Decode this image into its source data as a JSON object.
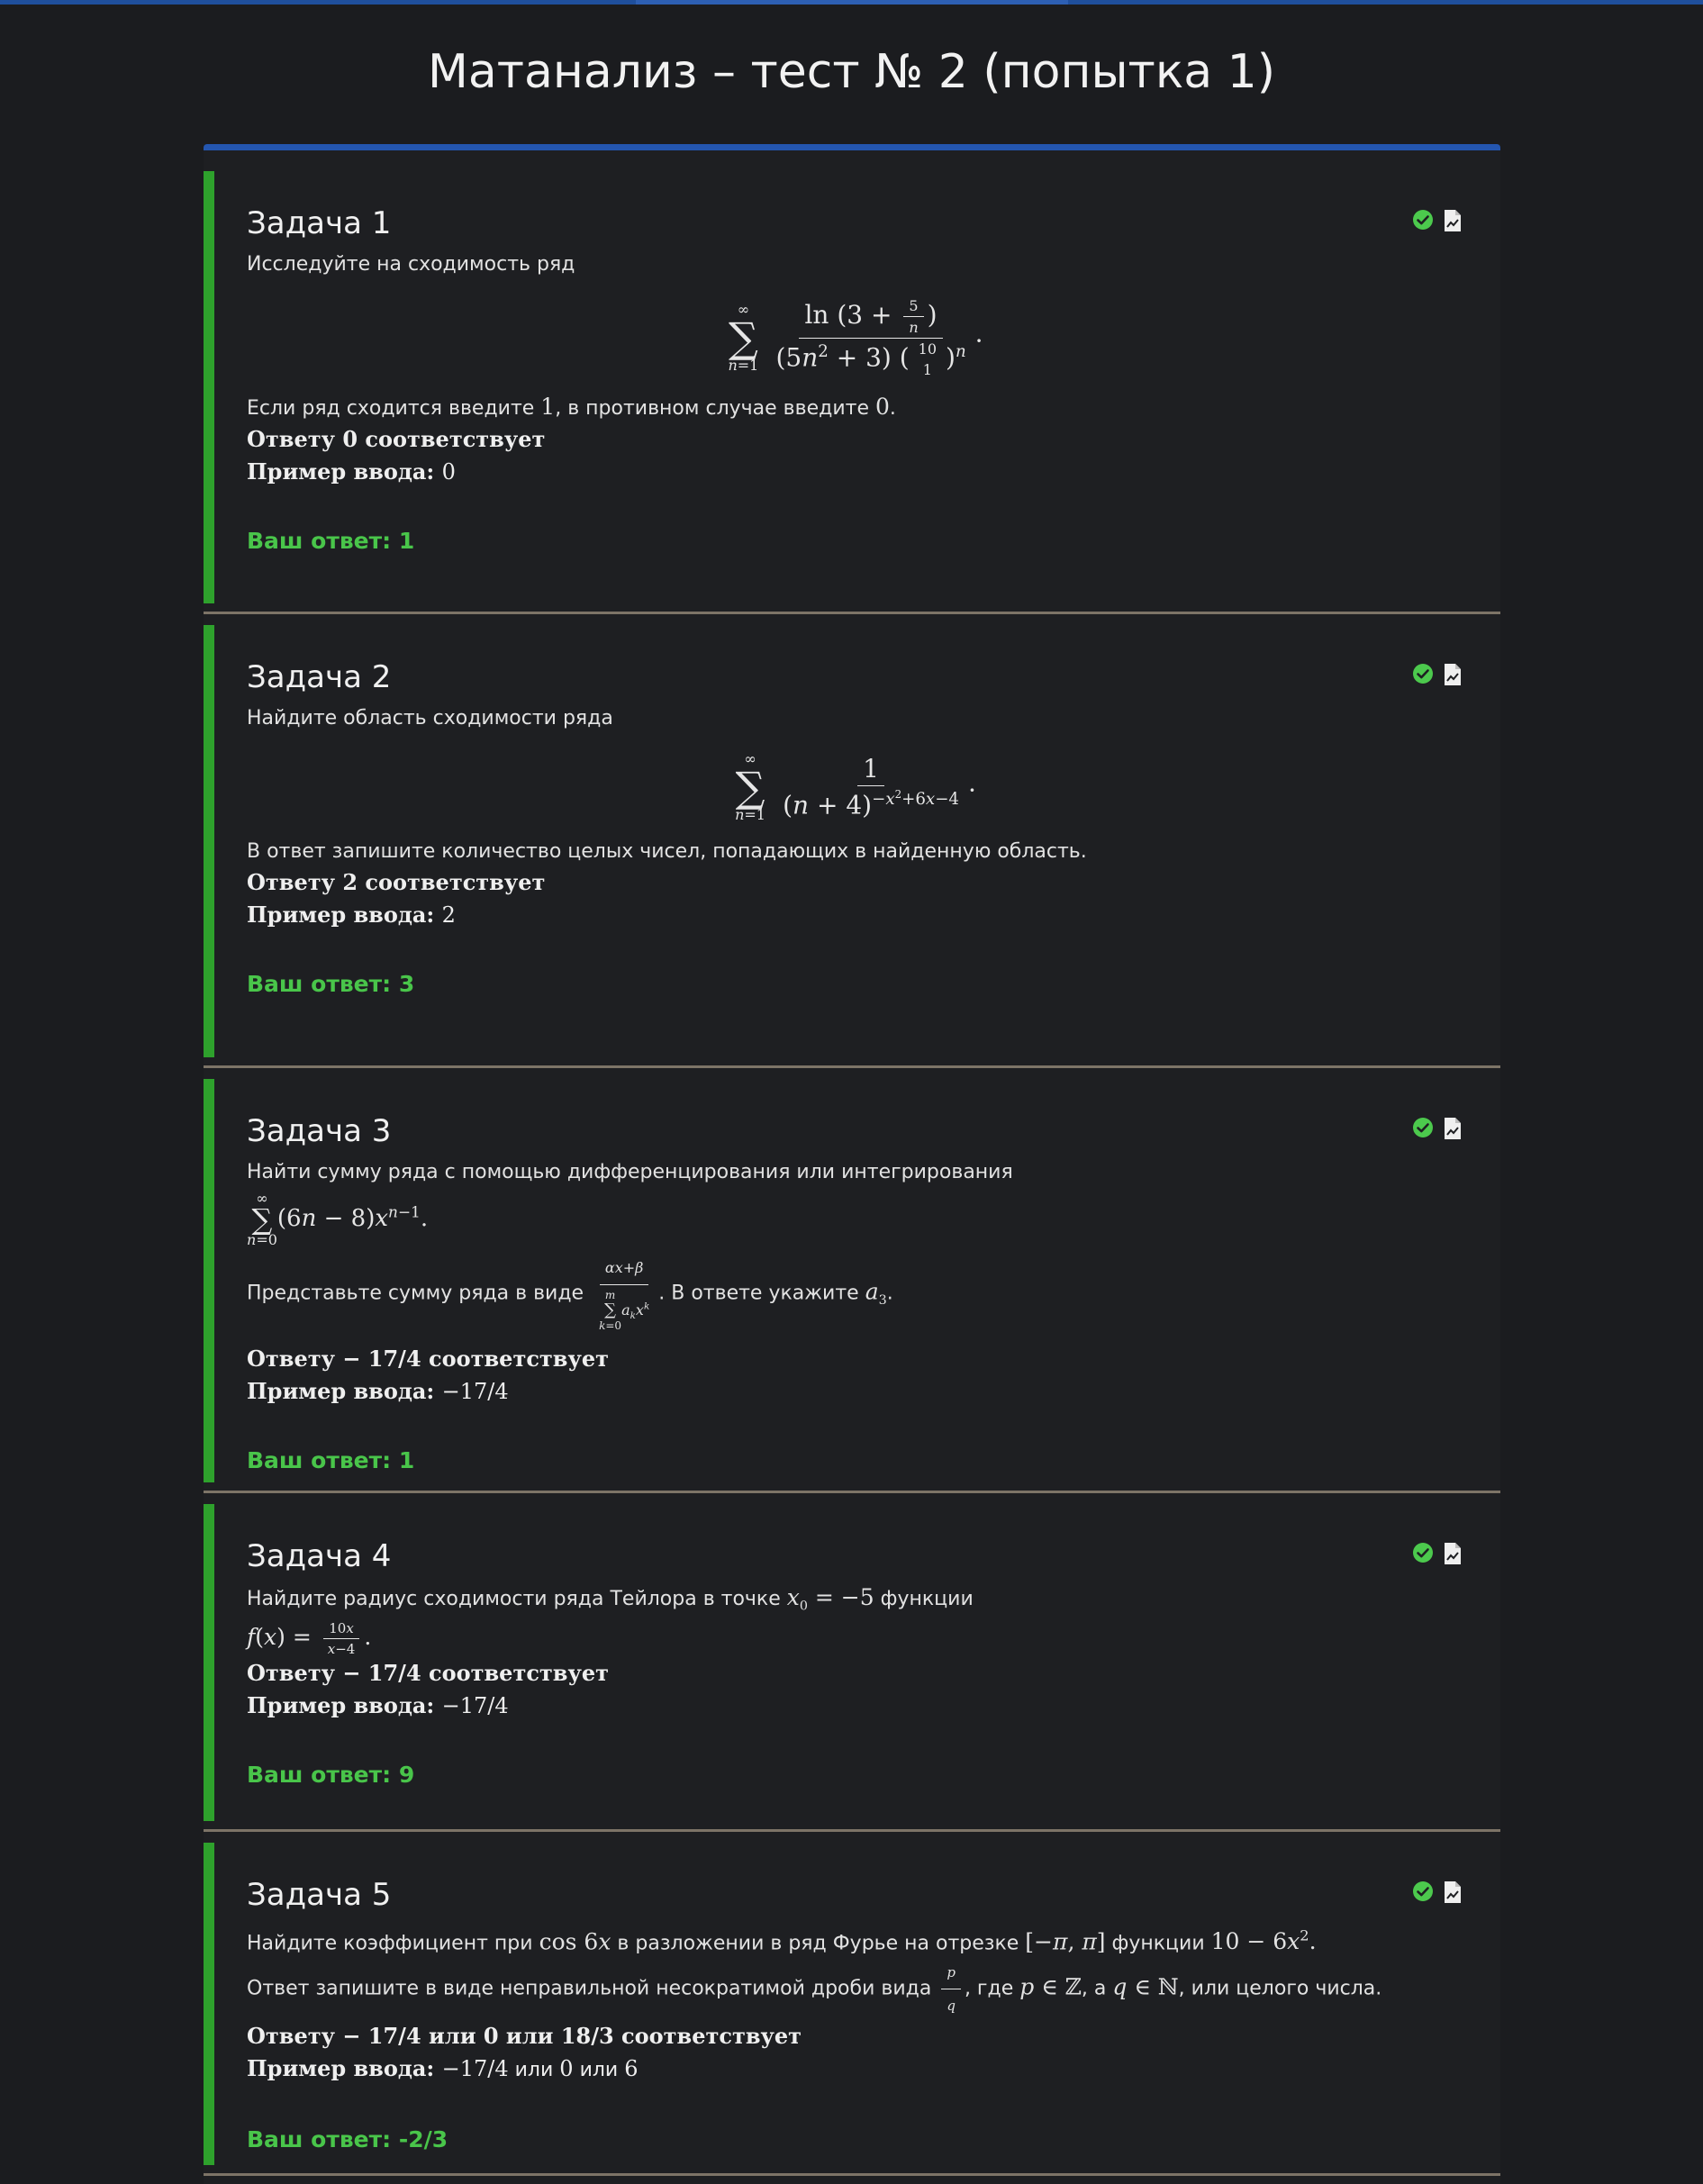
{
  "page": {
    "title": "Матанализ – тест № 2 (попытка 1)",
    "accent_color": "#2ea12c",
    "answer_color": "#49c54a",
    "header_color": "#2456b0",
    "divider_color": "#7d7467"
  },
  "tasks": [
    {
      "title": "Задача 1",
      "prompt": "Исследуйте на сходимость ряд",
      "instruction_before": "Если ряд сходится введите ",
      "instruction_one": "1",
      "instruction_mid": ", в противном случае введите ",
      "instruction_zero": "0",
      "instruction_end": ".",
      "correct_label": "Ответу ",
      "correct_value": "0",
      "correct_suffix": " соответствует",
      "example_label": "Пример ввода: ",
      "example_value": "0",
      "answer_label": "Ваш ответ: ",
      "answer_value": "1",
      "status_icon": "check-circle-icon",
      "file_icon": "file-chart-icon"
    },
    {
      "title": "Задача 2",
      "prompt": "Найдите область сходимости ряда",
      "instruction": "В ответ запишите количество целых чисел, попадающих в найденную область.",
      "correct_label": "Ответу ",
      "correct_value": "2",
      "correct_suffix": " соответствует",
      "example_label": "Пример ввода: ",
      "example_value": "2",
      "answer_label": "Ваш ответ: ",
      "answer_value": "3",
      "status_icon": "check-circle-icon",
      "file_icon": "file-chart-icon"
    },
    {
      "title": "Задача 3",
      "prompt": "Найти сумму ряда с помощью дифференцирования или интегрирования",
      "instruction_before": "Представьте сумму ряда в виде ",
      "instruction_after": ". В ответе укажите ",
      "correct_label": "Ответу ",
      "correct_value": "− 17/4",
      "correct_suffix": " соответствует",
      "example_label": "Пример ввода: ",
      "example_value": "−17/4",
      "answer_label": "Ваш ответ: ",
      "answer_value": "1",
      "status_icon": "check-circle-icon",
      "file_icon": "file-chart-icon"
    },
    {
      "title": "Задача 4",
      "prompt_before": "Найдите радиус сходимости ряда Тейлора в точке ",
      "prompt_after": " функции",
      "correct_label": "Ответу ",
      "correct_value": "− 17/4",
      "correct_suffix": " соответствует",
      "example_label": "Пример ввода: ",
      "example_value": "−17/4",
      "answer_label": "Ваш ответ: ",
      "answer_value": "9",
      "status_icon": "check-circle-icon",
      "file_icon": "file-chart-icon"
    },
    {
      "title": "Задача 5",
      "prompt_a": "Найдите коэффициент при ",
      "prompt_b": " в разложении в ряд Фурье на отрезке ",
      "prompt_c": " функции ",
      "instruction_a": "Ответ запишите в виде неправильной несократимой дроби вида ",
      "instruction_b": ", где ",
      "instruction_c": ", а ",
      "instruction_d": ", или целого числа.",
      "correct_label": "Ответу ",
      "correct_value": "− 17/4 или 0 или 18/3",
      "correct_suffix": " соответствует",
      "example_label": "Пример ввода: ",
      "example_value_1": "−17/4",
      "example_or_1": " или ",
      "example_value_2": "0",
      "example_or_2": " или ",
      "example_value_3": "6",
      "answer_label": "Ваш ответ: ",
      "answer_value": "-2/3",
      "status_icon": "check-circle-icon",
      "file_icon": "file-chart-icon"
    }
  ]
}
